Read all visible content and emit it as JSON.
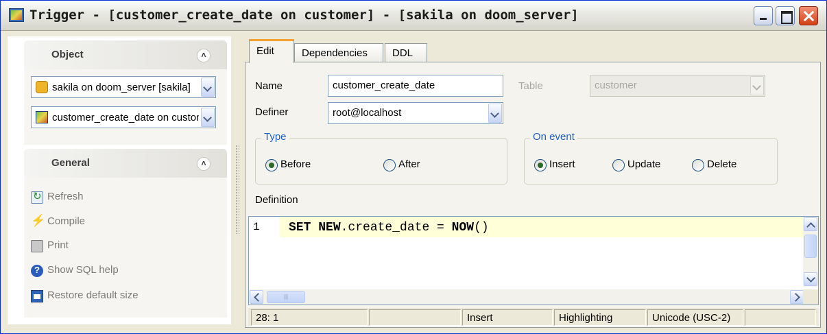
{
  "window": {
    "title": "Trigger - [customer_create_date on customer] - [sakila on doom_server]"
  },
  "left": {
    "object_section": {
      "title": "Object",
      "database_combo": "sakila on doom_server [sakila]",
      "trigger_combo": "customer_create_date on customer"
    },
    "general_section": {
      "title": "General",
      "actions": [
        {
          "label": "Refresh",
          "icon": "refresh-icon"
        },
        {
          "label": "Compile",
          "icon": "compile-icon"
        },
        {
          "label": "Print",
          "icon": "print-icon"
        },
        {
          "label": "Show SQL help",
          "icon": "help-icon"
        },
        {
          "label": "Restore default size",
          "icon": "restore-size-icon"
        }
      ]
    }
  },
  "tabs": [
    {
      "label": "Edit",
      "active": true
    },
    {
      "label": "Dependencies",
      "active": false
    },
    {
      "label": "DDL",
      "active": false
    }
  ],
  "form": {
    "name_label": "Name",
    "name_value": "customer_create_date",
    "table_label": "Table",
    "table_value": "customer",
    "definer_label": "Definer",
    "definer_value": "root@localhost",
    "type_group": {
      "title": "Type",
      "options": [
        {
          "label": "Before",
          "checked": true
        },
        {
          "label": "After",
          "checked": false
        }
      ]
    },
    "event_group": {
      "title": "On event",
      "options": [
        {
          "label": "Insert",
          "checked": true
        },
        {
          "label": "Update",
          "checked": false
        },
        {
          "label": "Delete",
          "checked": false
        }
      ]
    },
    "definition_label": "Definition"
  },
  "editor": {
    "line_number": "1",
    "code": "SET NEW.create_date = NOW()",
    "code_parts": [
      {
        "text": "SET",
        "keyword": true
      },
      {
        "text": " ",
        "keyword": false
      },
      {
        "text": "NEW",
        "keyword": true
      },
      {
        "text": ".create_date = ",
        "keyword": false
      },
      {
        "text": "NOW",
        "keyword": true
      },
      {
        "text": "()",
        "keyword": false
      }
    ]
  },
  "statusbar": {
    "position": "28:  1",
    "panel2": "",
    "mode": "Insert",
    "highlighting": "Highlighting",
    "encoding": "Unicode (USC-2)",
    "panel6": ""
  },
  "colors": {
    "tab_accent": "#f3a133",
    "group_title": "#2060c8",
    "code_line_highlight": "#ffffd8"
  }
}
